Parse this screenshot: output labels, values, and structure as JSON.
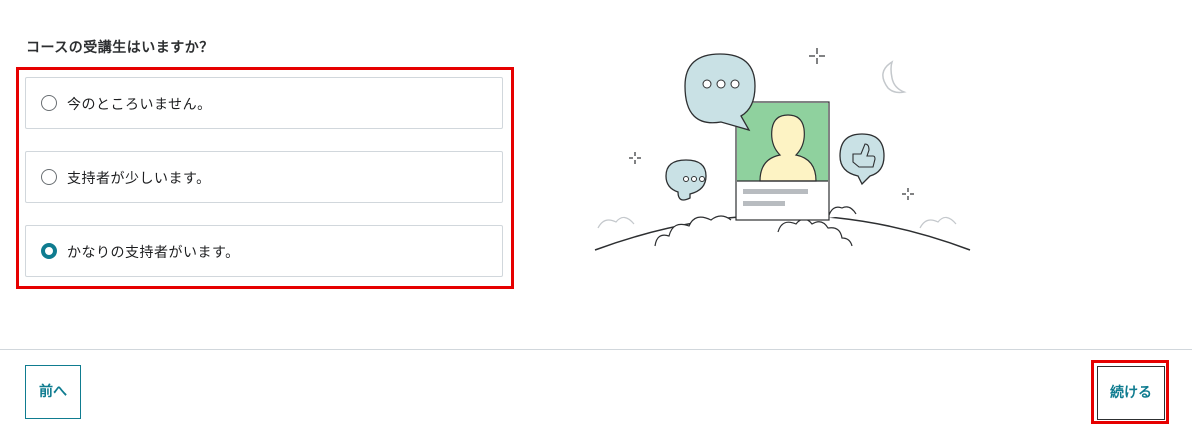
{
  "question": {
    "title": "コースの受講生はいますか？"
  },
  "options": [
    {
      "label": "今のところいません。",
      "selected": false
    },
    {
      "label": "支持者が少しいます。",
      "selected": false
    },
    {
      "label": "かなりの支持者がいます。",
      "selected": true
    }
  ],
  "footer": {
    "prev_label": "前へ",
    "next_label": "続ける"
  },
  "colors": {
    "accent": "#0f7c90",
    "highlight": "#e60000",
    "illustration_green": "#8fd19e",
    "bubble_blue": "#c9e1e5",
    "avatar_yellow": "#fdf3c4"
  },
  "icons": [
    "radio-empty-icon",
    "radio-checked-icon",
    "chat-bubble-icon",
    "thumbs-up-icon",
    "moon-icon",
    "sparkle-icon"
  ]
}
